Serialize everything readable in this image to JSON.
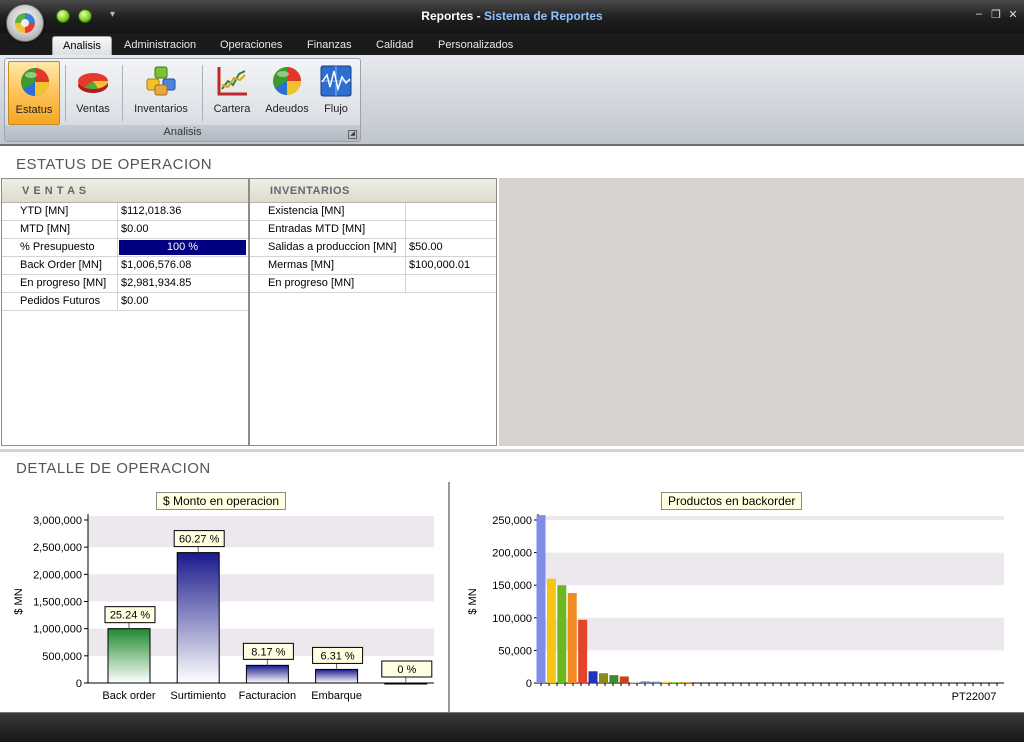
{
  "window": {
    "title": "Reportes",
    "separator": " - ",
    "subtitle": "Sistema de Reportes",
    "qat_more": "▾",
    "minimize": "–",
    "restore": "❐",
    "close": "✕"
  },
  "tabs": [
    {
      "label": "Analisis",
      "active": true
    },
    {
      "label": "Administracion"
    },
    {
      "label": "Operaciones"
    },
    {
      "label": "Finanzas"
    },
    {
      "label": "Calidad"
    },
    {
      "label": "Personalizados"
    }
  ],
  "ribbon": {
    "group_label": "Analisis",
    "launcher": "◢",
    "buttons": [
      {
        "label": "Estatus",
        "icon": "pie-globe-icon",
        "active": true
      },
      {
        "label": "Ventas",
        "icon": "pie-chart-icon"
      },
      {
        "label": "Inventarios",
        "icon": "cubes-icon"
      },
      {
        "label": "Cartera",
        "icon": "line-chart-icon"
      },
      {
        "label": "Adeudos",
        "icon": "pie-globe-icon"
      },
      {
        "label": "Flujo",
        "icon": "waveform-icon"
      }
    ]
  },
  "status_section": {
    "title": "ESTATUS DE OPERACION",
    "ventas": {
      "header": "V E N T A S",
      "rows": [
        {
          "label": "YTD [MN]",
          "value": "$112,018.36"
        },
        {
          "label": "MTD [MN]",
          "value": "$0.00"
        },
        {
          "label": "% Presupuesto",
          "value": "100 %",
          "progress": 1.0
        },
        {
          "label": "Back Order [MN]",
          "value": "$1,006,576.08"
        },
        {
          "label": "En progreso [MN]",
          "value": "$2,981,934.85"
        },
        {
          "label": "Pedidos Futuros",
          "value": "$0.00"
        }
      ]
    },
    "inventarios": {
      "header": "INVENTARIOS",
      "rows": [
        {
          "label": "Existencia [MN]",
          "value": ""
        },
        {
          "label": "Entradas MTD [MN]",
          "value": ""
        },
        {
          "label": "Salidas a produccion [MN]",
          "value": "$50.00"
        },
        {
          "label": "Mermas  [MN]",
          "value": "$100,000.01"
        },
        {
          "label": "En progreso [MN]",
          "value": ""
        }
      ]
    }
  },
  "detail_section": {
    "title": "DETALLE  DE OPERACION"
  },
  "chart_data": [
    {
      "type": "bar",
      "title": "$ Monto en operacion",
      "ylabel": "$ MN",
      "ylim": [
        0,
        3000000
      ],
      "yticks": [
        "0",
        "500,000",
        "1,000,000",
        "1,500,000",
        "2,000,000",
        "2,500,000",
        "3,000,000"
      ],
      "categories": [
        "Back order",
        "Surtimiento",
        "Facturacion",
        "Embarque",
        ""
      ],
      "values": [
        1000000,
        2400000,
        325000,
        250000,
        0
      ],
      "data_labels": [
        "25.24 %",
        "60.27 %",
        "8.17 %",
        "6.31 %",
        "0 %"
      ],
      "colors": [
        "#1e8a2e",
        "#1a1a8c",
        "#1a1a8c",
        "#1a1a8c",
        "#1a1a8c"
      ],
      "grid": "bands"
    },
    {
      "type": "bar",
      "title": "Productos en backorder",
      "ylabel": "$ MN",
      "ylim": [
        0,
        250000
      ],
      "yticks": [
        "0",
        "50,000",
        "100,000",
        "150,000",
        "200,000",
        "250,000"
      ],
      "categories_visible": [
        "PT22007"
      ],
      "values": [
        258000,
        160000,
        150000,
        138000,
        97000,
        18000,
        15000,
        12000,
        10000,
        2000,
        2500,
        2000,
        2000,
        1500,
        1500
      ],
      "colors": [
        "#7f8de8",
        "#f5c518",
        "#6db81f",
        "#f08a22",
        "#e2452a",
        "#2430b8",
        "#8a8a14",
        "#3e8a2e",
        "#c84418",
        "#d8d8d8",
        "#7a8aa0",
        "#6a8ad0",
        "#f5d048",
        "#9ad04a",
        "#f0a040"
      ],
      "grid": "bands"
    }
  ]
}
